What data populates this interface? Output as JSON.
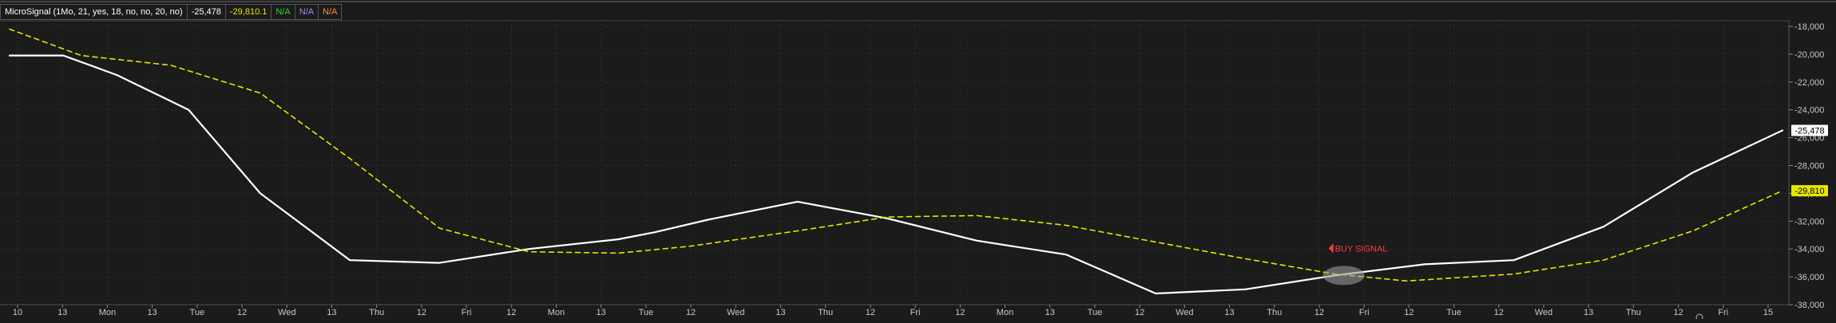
{
  "header": {
    "study_label": "MicroSignal (1Mo, 21, yes, 18, no, no, 20, no)",
    "main_value": "-25,478",
    "signal_value": "-29,810.1",
    "na_1": "N/A",
    "na_2": "N/A",
    "na_3": "N/A"
  },
  "colors": {
    "background": "#1b1b1b",
    "grid": "#3c3c3c",
    "main_line": "#ffffff",
    "signal_line": "#e6e600",
    "na_1": "#3fcf3f",
    "na_2": "#9a8cff",
    "na_3": "#ff8a3d",
    "buy_signal": "#ff3b3b"
  },
  "chart_data": {
    "type": "line",
    "x_tick_labels": [
      "10",
      "13",
      "Mon",
      "13",
      "Tue",
      "12",
      "Wed",
      "13",
      "Thu",
      "12",
      "Fri",
      "12",
      "Mon",
      "13",
      "Tue",
      "12",
      "Wed",
      "13",
      "Thu",
      "12",
      "Fri",
      "12",
      "Mon",
      "13",
      "Tue",
      "12",
      "Wed",
      "13",
      "Thu",
      "12",
      "Fri",
      "12",
      "Tue",
      "12",
      "Wed",
      "13",
      "Thu",
      "12",
      "Fri",
      "15"
    ],
    "y_tick_labels": [
      "-18,000",
      "-20,000",
      "-22,000",
      "-24,000",
      "-26,000",
      "-28,000",
      "-30,000",
      "-32,000",
      "-34,000",
      "-36,000",
      "-38,000"
    ],
    "ylim": [
      -38000,
      -17600
    ],
    "grid": true,
    "x_index_range": [
      0,
      99
    ],
    "series": [
      {
        "key": "main",
        "style": "solid",
        "x": [
          0,
          3,
          6,
          10,
          14,
          19,
          24,
          29,
          34,
          36,
          39,
          44,
          49,
          54,
          59,
          64,
          69,
          74,
          79,
          84,
          89,
          94,
          99
        ],
        "y": [
          -20100,
          -20100,
          -21500,
          -24000,
          -30000,
          -34800,
          -35000,
          -34000,
          -33300,
          -32800,
          -31900,
          -30600,
          -31800,
          -33400,
          -34400,
          -37200,
          -36900,
          -35900,
          -35100,
          -34800,
          -32400,
          -28500,
          -25478
        ]
      },
      {
        "key": "signal",
        "style": "dashed",
        "x": [
          0,
          4,
          9,
          14,
          19,
          24,
          29,
          34,
          38,
          44,
          49,
          54,
          59,
          64,
          69,
          74,
          78,
          84,
          89,
          94,
          99
        ],
        "y": [
          -18200,
          -20100,
          -20800,
          -22800,
          -27500,
          -32500,
          -34200,
          -34300,
          -33800,
          -32700,
          -31700,
          -31600,
          -32300,
          -33500,
          -34700,
          -35800,
          -36300,
          -35800,
          -34800,
          -32700,
          -29810
        ]
      }
    ],
    "price_markers": [
      {
        "label": "-25,478",
        "value": -25478,
        "series": "main"
      },
      {
        "label": "-29,810",
        "value": -29810,
        "series": "signal"
      }
    ],
    "annotations": [
      {
        "text": "BUY SIGNAL",
        "x": 74.5,
        "y": -35900
      }
    ]
  }
}
